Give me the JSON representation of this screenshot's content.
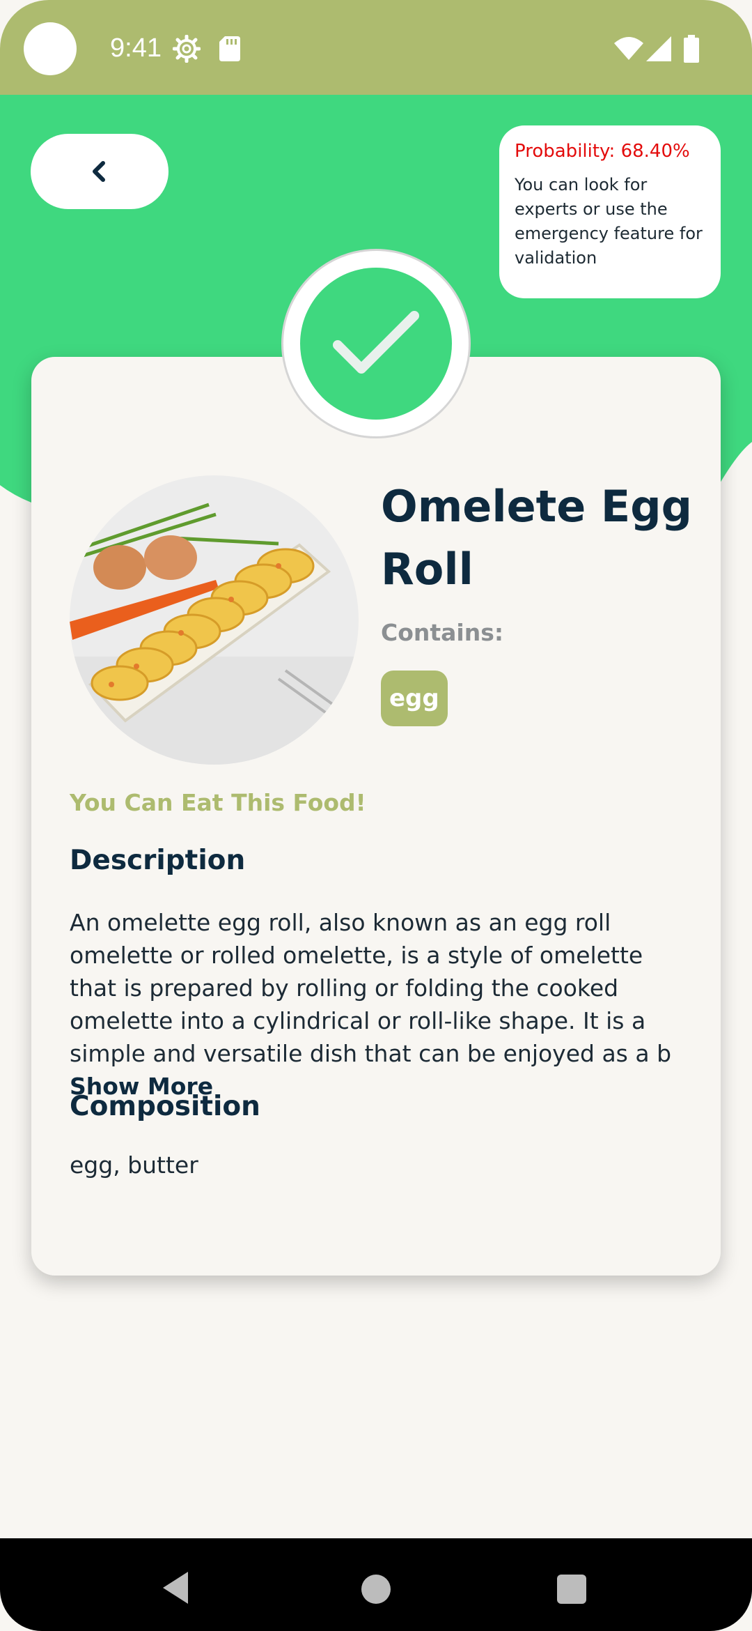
{
  "status_bar": {
    "time": "9:41",
    "icons": [
      "camera-dot",
      "gear-icon",
      "sd-card-icon",
      "wifi-icon",
      "signal-icon",
      "battery-icon"
    ]
  },
  "colors": {
    "header_green": "#3fd87f",
    "status_olive": "#adbb6f",
    "navy": "#0e2a3f",
    "probability_red": "#e30b0b",
    "background": "#f8f6f2"
  },
  "header": {
    "back_icon": "chevron-left-icon",
    "probability": {
      "label": "Probability: 68.40%",
      "message": "You can look for experts or use the emergency feature for validation"
    },
    "status_icon": "check-icon"
  },
  "food": {
    "name": "Omelete Egg Roll",
    "contains_label": "Contains:",
    "allergens": [
      "egg"
    ],
    "verdict": "You Can Eat This Food!",
    "description_heading": "Description",
    "description": "An omelette egg roll, also known as an egg roll omelette or rolled omelette, is a style of omelette that is prepared by rolling or folding the cooked omelette into a cylindrical or roll-like shape. It is a simple and versatile dish that can be enjoyed as a b",
    "show_more_label": "Show More",
    "composition_heading": "Composition",
    "composition": "egg, butter"
  },
  "nav_bar": {
    "items": [
      "back-icon",
      "home-icon",
      "recents-icon"
    ]
  }
}
